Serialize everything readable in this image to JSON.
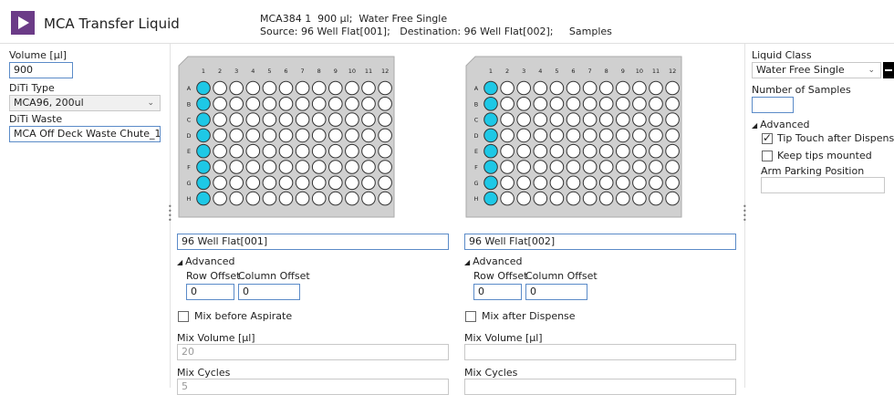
{
  "header": {
    "app_title": "MCA Transfer Liquid",
    "line1": "MCA384 1  900 µl;  Water Free Single",
    "line2": "Source: 96 Well Flat[001];   Destination: 96 Well Flat[002];     Samples"
  },
  "left_panel": {
    "volume_label": "Volume [µl]",
    "volume_value": "900",
    "diti_type_label": "DiTi Type",
    "diti_type_value": "MCA96, 200ul",
    "diti_waste_label": "DiTi Waste",
    "diti_waste_value": "MCA Off Deck Waste Chute_1"
  },
  "plates": {
    "column_labels": [
      "1",
      "2",
      "3",
      "4",
      "5",
      "6",
      "7",
      "8",
      "9",
      "10",
      "11",
      "12"
    ],
    "row_labels": [
      "A",
      "B",
      "C",
      "D",
      "E",
      "F",
      "G",
      "H"
    ],
    "selected_column": 1,
    "selected_color": "#1ec8e6"
  },
  "source": {
    "plate_name": "96 Well Flat[001]",
    "advanced_label": "Advanced",
    "row_offset_label": "Row Offset",
    "column_offset_label": "Column Offset",
    "row_offset_value": "0",
    "column_offset_value": "0",
    "mix_label": "Mix before Aspirate",
    "mix_volume_label": "Mix Volume [µl]",
    "mix_volume_value": "20",
    "mix_cycles_label": "Mix Cycles",
    "mix_cycles_value": "5"
  },
  "destination": {
    "plate_name": "96 Well Flat[002]",
    "advanced_label": "Advanced",
    "row_offset_label": "Row Offset",
    "column_offset_label": "Column Offset",
    "row_offset_value": "0",
    "column_offset_value": "0",
    "mix_label": "Mix after Dispense",
    "mix_volume_label": "Mix Volume [µl]",
    "mix_volume_value": "",
    "mix_cycles_label": "Mix Cycles",
    "mix_cycles_value": ""
  },
  "right_panel": {
    "liquid_class_label": "Liquid Class",
    "liquid_class_value": "Water Free Single",
    "num_samples_label": "Number of Samples",
    "num_samples_value": "",
    "advanced_label": "Advanced",
    "tip_touch_label": "Tip Touch after Dispense",
    "tip_touch_checked": true,
    "keep_tips_label": "Keep tips mounted",
    "keep_tips_checked": false,
    "arm_parking_label": "Arm Parking Position",
    "arm_parking_value": ""
  }
}
